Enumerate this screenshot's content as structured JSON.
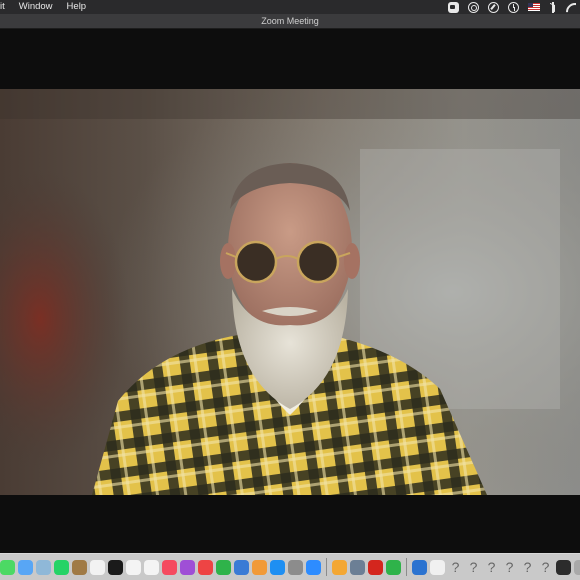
{
  "menubar": {
    "items": [
      "it",
      "Window",
      "Help"
    ],
    "status_icons": [
      "zoom-icon",
      "creative-cloud-icon",
      "sync-icon",
      "time-machine-icon",
      "us-flag-icon",
      "bluetooth-icon",
      "wifi-icon"
    ]
  },
  "window": {
    "title": "Zoom Meeting"
  },
  "video": {
    "participant": "webcam-feed"
  },
  "dock": {
    "apps": [
      {
        "name": "messages-app-icon",
        "color": "#4cd964"
      },
      {
        "name": "finder-app-icon",
        "color": "#58a6f5"
      },
      {
        "name": "preview-app-icon",
        "color": "#8fb8d8"
      },
      {
        "name": "whatsapp-app-icon",
        "color": "#25d366"
      },
      {
        "name": "notes-app-icon",
        "color": "#a07a45"
      },
      {
        "name": "calendar-app-icon",
        "color": "#f2f2f2"
      },
      {
        "name": "apple-tv-app-icon",
        "color": "#1a1a1a"
      },
      {
        "name": "textedit-app-icon",
        "color": "#f4f4f4"
      },
      {
        "name": "stickies-app-icon",
        "color": "#f4f4f4"
      },
      {
        "name": "music-app-icon",
        "color": "#f54a5f"
      },
      {
        "name": "podcasts-app-icon",
        "color": "#9f4fd6"
      },
      {
        "name": "blocker-app-icon",
        "color": "#e44"
      },
      {
        "name": "numbers-app-icon",
        "color": "#2fb34a"
      },
      {
        "name": "keynote-app-icon",
        "color": "#3a7bd5"
      },
      {
        "name": "pages-app-icon",
        "color": "#f19a38"
      },
      {
        "name": "app-store-app-icon",
        "color": "#1e8ff2"
      },
      {
        "name": "system-preferences-app-icon",
        "color": "#8c8c8c"
      },
      {
        "name": "zoom-app-icon",
        "color": "#2d8cff"
      },
      {
        "name": "separator"
      },
      {
        "name": "image-capture-app-icon",
        "color": "#f3a733"
      },
      {
        "name": "photo-browser-app-icon",
        "color": "#6c7f95"
      },
      {
        "name": "acrobat-app-icon",
        "color": "#d4261e"
      },
      {
        "name": "chrome-app-icon",
        "color": "#2fb34a"
      },
      {
        "name": "separator"
      },
      {
        "name": "network-globe-app-icon",
        "color": "#2b73d0"
      },
      {
        "name": "document-app-icon",
        "color": "#f0f0f0"
      },
      {
        "name": "unknown-app-icon-1",
        "glyph": "?"
      },
      {
        "name": "unknown-app-icon-2",
        "glyph": "?"
      },
      {
        "name": "unknown-app-icon-3",
        "glyph": "?"
      },
      {
        "name": "unknown-app-icon-4",
        "glyph": "?"
      },
      {
        "name": "unknown-app-icon-5",
        "glyph": "?"
      },
      {
        "name": "unknown-app-icon-6",
        "glyph": "?"
      },
      {
        "name": "terminal-app-icon",
        "color": "#2c2c2c"
      },
      {
        "name": "trash-app-icon",
        "color": "#a9a9a9"
      }
    ]
  }
}
